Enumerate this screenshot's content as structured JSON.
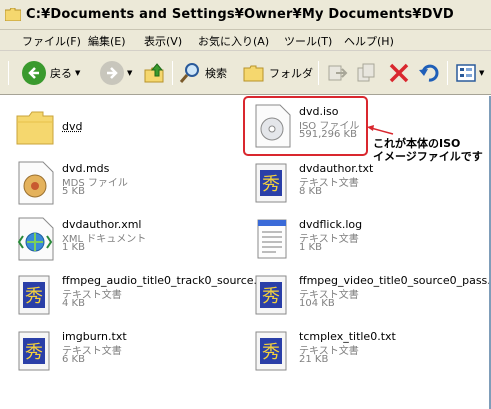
{
  "window": {
    "title": "C:¥Documents and Settings¥Owner¥My Documents¥DVD"
  },
  "menu": [
    "ファイル(F)",
    "編集(E)",
    "表示(V)",
    "お気に入り(A)",
    "ツール(T)",
    "ヘルプ(H)"
  ],
  "toolbar": {
    "back_label": "戻る",
    "search_label": "検索",
    "folders_label": "フォルダ"
  },
  "files": [
    {
      "name": "dvd",
      "type": "",
      "size": "",
      "icon": "folder-icon"
    },
    {
      "name": "dvd.iso",
      "type": "ISO ファイル",
      "size": "591,296 KB",
      "icon": "disc-image-icon"
    },
    {
      "name": "dvd.mds",
      "type": "MDS ファイル",
      "size": "5 KB",
      "icon": "mds-file-icon"
    },
    {
      "name": "dvdauthor.txt",
      "type": "テキスト文書",
      "size": "8 KB",
      "icon": "text-document-icon"
    },
    {
      "name": "dvdauthor.xml",
      "type": "XML ドキュメント",
      "size": "1 KB",
      "icon": "xml-document-icon"
    },
    {
      "name": "dvdflick.log",
      "type": "テキスト文書",
      "size": "1 KB",
      "icon": "notepad-log-icon"
    },
    {
      "name": "ffmpeg_audio_title0_track0_source...",
      "type": "テキスト文書",
      "size": "4 KB",
      "icon": "text-document-icon"
    },
    {
      "name": "ffmpeg_video_title0_source0_pass...",
      "type": "テキスト文書",
      "size": "104 KB",
      "icon": "text-document-icon"
    },
    {
      "name": "imgburn.txt",
      "type": "テキスト文書",
      "size": "6 KB",
      "icon": "text-document-icon"
    },
    {
      "name": "tcmplex_title0.txt",
      "type": "テキスト文書",
      "size": "21 KB",
      "icon": "text-document-icon"
    }
  ],
  "annotation": {
    "line1": "これが本体のISO",
    "line2": "イメージファイルです"
  },
  "colors": {
    "highlight": "#d9272e",
    "chrome": "#ece9d8",
    "subtext": "#808080"
  }
}
